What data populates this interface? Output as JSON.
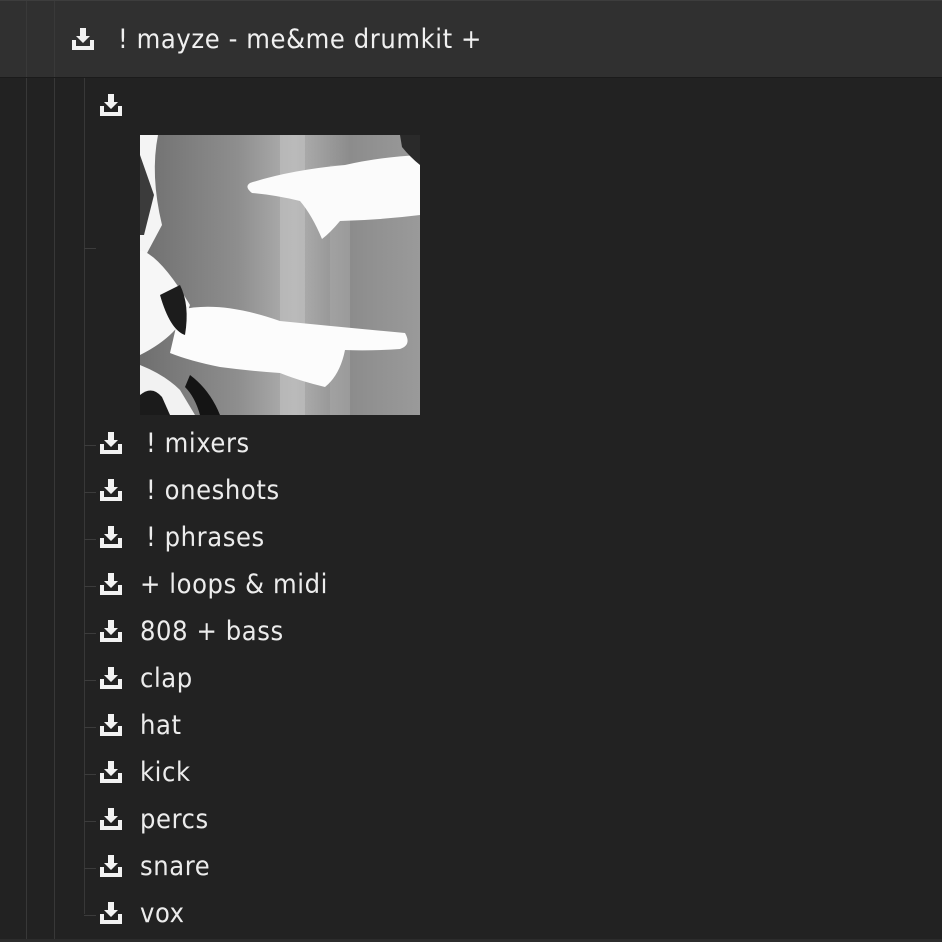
{
  "folder": {
    "title": "! mayze - me&me drumkit +",
    "icon": "download-icon"
  },
  "cover_entry": {
    "label": "",
    "icon": "download-icon",
    "image": "cover-art-image"
  },
  "items": [
    {
      "label": "! mixers",
      "icon": "download-icon"
    },
    {
      "label": "! oneshots",
      "icon": "download-icon"
    },
    {
      "label": "! phrases",
      "icon": "download-icon"
    },
    {
      "label": "+ loops & midi",
      "icon": "download-icon"
    },
    {
      "label": "808 + bass",
      "icon": "download-icon"
    },
    {
      "label": "clap",
      "icon": "download-icon"
    },
    {
      "label": "hat",
      "icon": "download-icon"
    },
    {
      "label": "kick",
      "icon": "download-icon"
    },
    {
      "label": "percs",
      "icon": "download-icon"
    },
    {
      "label": "snare",
      "icon": "download-icon"
    },
    {
      "label": "vox",
      "icon": "download-icon"
    }
  ],
  "colors": {
    "background": "#222222",
    "header": "#303030",
    "text": "#ececec",
    "guide_lines": "#383838"
  }
}
